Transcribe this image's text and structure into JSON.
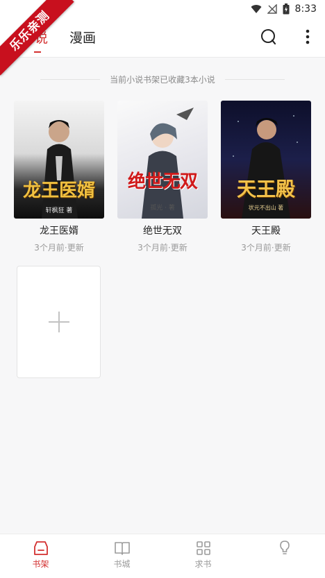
{
  "status_bar": {
    "time": "8:33"
  },
  "ribbon": {
    "text": "乐乐亲测"
  },
  "header": {
    "tabs": [
      {
        "label": "小说",
        "visible_label": "说",
        "active": true
      },
      {
        "label": "漫画",
        "active": false
      }
    ]
  },
  "notice": "当前小说书架已收藏3本小说",
  "books": [
    {
      "title": "龙王医婿",
      "meta": "3个月前·更新",
      "cover_text": "龙王医婿",
      "cover_author": "轩枫狂 著"
    },
    {
      "title": "绝世无双",
      "meta": "3个月前·更新",
      "cover_text": "绝世无双",
      "cover_author": "孤光 · 著"
    },
    {
      "title": "天王殿",
      "meta": "3个月前·更新",
      "cover_text": "天王殿",
      "cover_author": "状元不出山 著"
    }
  ],
  "bottom_nav": [
    {
      "label": "书架",
      "icon": "bookshelf-icon",
      "active": true
    },
    {
      "label": "书城",
      "icon": "book-open-icon",
      "active": false
    },
    {
      "label": "求书",
      "icon": "grid-icon",
      "active": false
    },
    {
      "label": "",
      "icon": "lightbulb-icon",
      "active": false
    }
  ],
  "colors": {
    "accent": "#d32f2f",
    "ribbon": "#c8101e"
  }
}
